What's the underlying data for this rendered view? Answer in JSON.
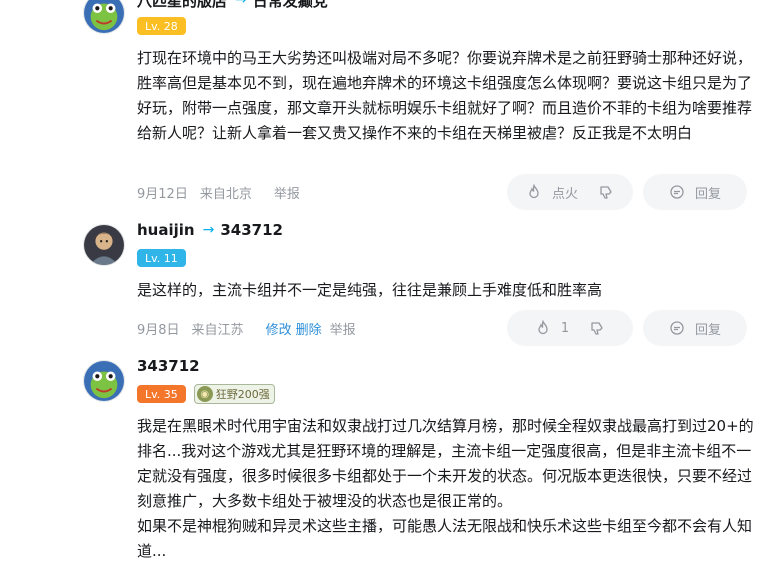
{
  "comments": [
    {
      "username": "八匹星的版店",
      "reply_to": "日常发癫党",
      "level": "Lv. 28",
      "content": "打现在环境中的马王大劣势还叫极端对局不多呢？你要说弃牌术是之前狂野骑士那种还好说，胜率高但是基本见不到，现在遍地弃牌术的环境这卡组强度怎么体现啊？要说这卡组只是为了好玩，附带一点强度，那文章开头就标明娱乐卡组就好了啊？而且造价不菲的卡组为啥要推荐给新人呢？让新人拿着一套又贵又操作不来的卡组在天梯里被虐？反正我是不太明白",
      "date": "9月12日",
      "location": "来自北京",
      "report": "举报",
      "like_label": "点火",
      "reply_label": "回复"
    },
    {
      "username": "huaijin",
      "reply_to": "343712",
      "level": "Lv. 11",
      "content": "是这样的，主流卡组并不一定是纯强，往往是兼顾上手难度低和胜率高",
      "date": "9月8日",
      "location": "来自江苏",
      "edit": "修改",
      "delete": "删除",
      "report": "举报",
      "like_count": "1",
      "reply_label": "回复"
    },
    {
      "username": "343712",
      "level": "Lv. 35",
      "medal": "狂野200强",
      "content": "我是在黑眼术时代用宇宙法和奴隶战打过几次结算月榜，那时候全程奴隶战最高打到过20+的排名...我对这个游戏尤其是狂野环境的理解是，主流卡组一定强度很高，但是非主流卡组不一定就没有强度，很多时候很多卡组都处于一个未开发的状态。何况版本更迭很快，只要不经过刻意推广，大多数卡组处于被埋没的状态也是很正常的。\n如果不是神棍狗贼和异灵术这些主播，可能愚人法无限战和快乐术这些卡组至今都不会有人知道..."
    }
  ],
  "colors": {
    "accent": "#00aeec",
    "lv28": "#fbbf24",
    "lv11": "#2fb5e8",
    "lv35": "#f4762b",
    "link": "#2f8fd8"
  },
  "icons": {
    "like": "flame-icon",
    "dislike": "thumb-down-icon",
    "reply": "speech-bubble-icon",
    "reply_arrow": "reply-arrow-icon"
  }
}
